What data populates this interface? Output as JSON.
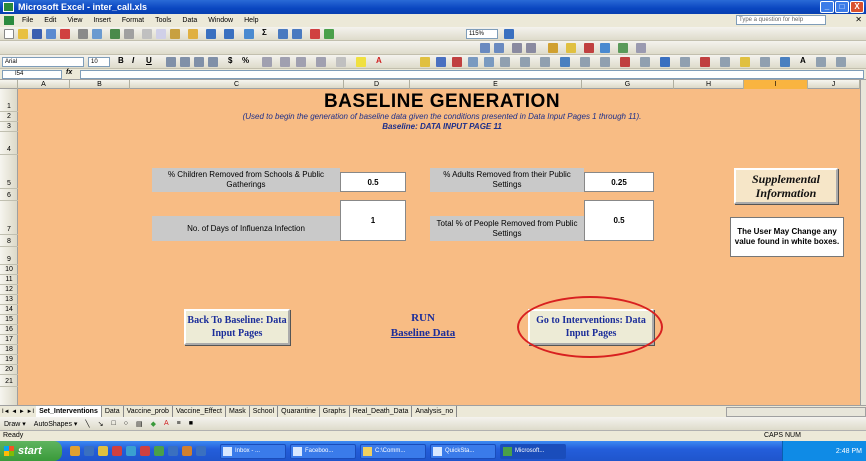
{
  "window": {
    "title": "Microsoft Excel - inter_call.xls",
    "buttons": [
      "_",
      "□",
      "X"
    ]
  },
  "menu": {
    "items": [
      "File",
      "Edit",
      "View",
      "Insert",
      "Format",
      "Tools",
      "Data",
      "Window",
      "Help"
    ],
    "help_placeholder": "Type a question for help"
  },
  "toolbar": {
    "zoom": "115%",
    "font": "Arial",
    "font_size": "10",
    "bold": "B",
    "italic": "I",
    "underline": "U",
    "currency": "$",
    "percent": "%"
  },
  "formula_bar": {
    "name_box": "I54",
    "fx": "fx",
    "value": ""
  },
  "columns": [
    "A",
    "B",
    "C",
    "D",
    "E",
    "G",
    "H",
    "I",
    "J"
  ],
  "active_column": "I",
  "rows": [
    "1",
    "2",
    "3",
    "4",
    "5",
    "6",
    "7",
    "8",
    "9",
    "10",
    "11",
    "12",
    "13",
    "14",
    "15",
    "16",
    "17",
    "18",
    "19",
    "20",
    "21"
  ],
  "sheet": {
    "title": "BASELINE GENERATION",
    "subtitle": "(Used to begin the generation of baseline data given the conditions presented in Data Input Pages 1 through 11).",
    "subtitle2": "Baseline: DATA INPUT PAGE 11",
    "fields": {
      "children_label": "% Children Removed from Schools & Public Gatherings",
      "children_value": "0.5",
      "adults_label": "% Adults Removed from their Public Settings",
      "adults_value": "0.25",
      "days_label": "No. of Days of Influenza Infection",
      "days_value": "1",
      "total_label": "Total % of People Removed from Public Settings",
      "total_value": "0.5"
    },
    "supplemental": "Supplemental Information",
    "note": "The User May Change any value found in white boxes.",
    "back_button": "Back To Baseline: Data Input Pages",
    "run_line1": "RUN",
    "run_line2": "Baseline Data",
    "go_button": "Go to Interventions: Data Input Pages"
  },
  "tabs": {
    "nav": "I◄ ◄ ► ►I",
    "items": [
      "Set_Interventions",
      "Data",
      "Vaccine_prob",
      "Vaccine_Effect",
      "Mask",
      "School",
      "Quarantine",
      "Graphs",
      "Real_Death_Data",
      "Analysis_no"
    ],
    "active": "Set_Interventions"
  },
  "drawbar": {
    "draw": "Draw ▾",
    "autoshapes": "AutoShapes ▾"
  },
  "status": {
    "left": "Ready",
    "right": "CAPS NUM"
  },
  "taskbar": {
    "start": "start",
    "items": [
      "Inbox - ...",
      "Faceboo...",
      "C:\\Comm...",
      "QuickSta...",
      "Microsoft..."
    ],
    "clock": "2:48 PM"
  }
}
